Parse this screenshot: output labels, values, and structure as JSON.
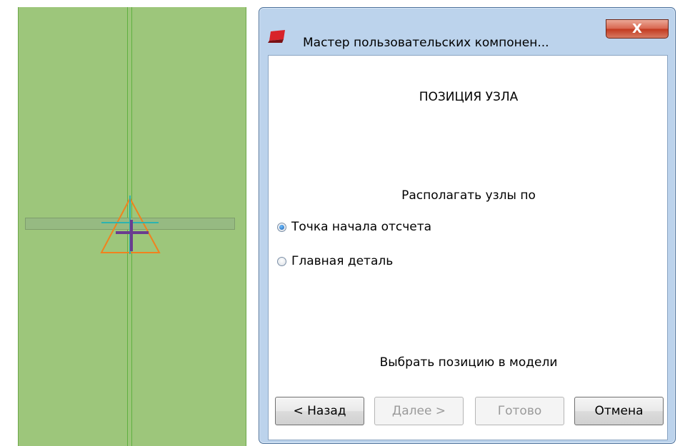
{
  "dialog": {
    "title": "Мастер пользовательских компонен...",
    "close_label": "X",
    "heading": "ПОЗИЦИЯ УЗЛА",
    "position_by_label": "Располагать узлы по",
    "options": [
      {
        "label": "Точка начала отсчета",
        "checked": true
      },
      {
        "label": "Главная деталь",
        "checked": false
      }
    ],
    "select_in_model_label": "Выбрать позицию в модели",
    "buttons": {
      "back": "< Назад",
      "next": "Далее >",
      "finish": "Готово",
      "cancel": "Отмена"
    }
  },
  "viewport": {
    "beam_color": "#9dc67b",
    "marker_color": "#f0821e",
    "axis_color": "#6a3d8f"
  }
}
